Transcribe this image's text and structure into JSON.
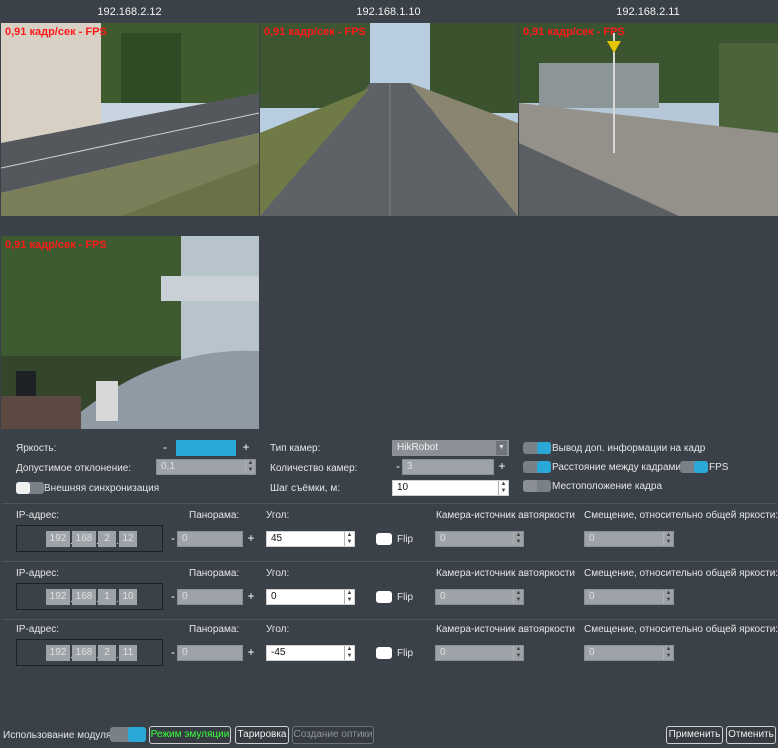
{
  "cameras": [
    {
      "ip": "192.168.2.12",
      "fps_label": "0,91 кадр/сек - FPS"
    },
    {
      "ip": "192.168.1.10",
      "fps_label": "0,91 кадр/сек - FPS"
    },
    {
      "ip": "192.168.2.11",
      "fps_label": "0,91 кадр/сек - FPS"
    },
    {
      "fps_label": "0,91 кадр/сек - FPS"
    }
  ],
  "settings": {
    "brightness_label": "Яркость:",
    "deviation_label": "Допустимое отклонение:",
    "deviation_value": "0,1",
    "external_sync_label": "Внешняя синхронизация",
    "camera_type_label": "Тип камер:",
    "camera_type_value": "HikRobot",
    "camera_count_label": "Количество камер:",
    "camera_count_value": "3",
    "step_label": "Шаг съёмки, м:",
    "step_value": "10",
    "extra_info_label": "Вывод доп. информации на кадр",
    "frame_distance_label": "Расстояние между кадрами",
    "fps_label": "FPS",
    "frame_location_label": "Местоположение кадра"
  },
  "rows": [
    {
      "ip_label": "IP-адрес:",
      "ip": [
        "192",
        "168",
        "2",
        "12"
      ],
      "panorama_label": "Панорама:",
      "panorama_value": "0",
      "angle_label": "Угол:",
      "angle_value": "45",
      "flip_label": "Flip",
      "source_label": "Камера-источник автояркости",
      "source_value": "0",
      "offset_label": "Смещение, относительно общей яркости:",
      "offset_value": "0"
    },
    {
      "ip_label": "IP-адрес:",
      "ip": [
        "192",
        "168",
        "1",
        "10"
      ],
      "panorama_label": "Панорама:",
      "panorama_value": "0",
      "angle_label": "Угол:",
      "angle_value": "0",
      "flip_label": "Flip",
      "source_label": "Камера-источник автояркости",
      "source_value": "0",
      "offset_label": "Смещение, относительно общей яркости:",
      "offset_value": "0"
    },
    {
      "ip_label": "IP-адрес:",
      "ip": [
        "192",
        "168",
        "2",
        "11"
      ],
      "panorama_label": "Панорама:",
      "panorama_value": "0",
      "angle_label": "Угол:",
      "angle_value": "-45",
      "flip_label": "Flip",
      "source_label": "Камера-источник автояркости",
      "source_value": "0",
      "offset_label": "Смещение, относительно общей яркости:",
      "offset_value": "0"
    }
  ],
  "bottom": {
    "module_label": "Использование модуля",
    "emulation_label": "Режим эмуляции",
    "calibration_label": "Тарировка",
    "optics_label": "Создание оптики",
    "apply_label": "Применить",
    "cancel_label": "Отменить"
  },
  "colors": {
    "accent": "#2aa8d8",
    "fps_text": "#ff1a1a",
    "emulation_text": "#3cff3c",
    "background": "#3a4148"
  }
}
